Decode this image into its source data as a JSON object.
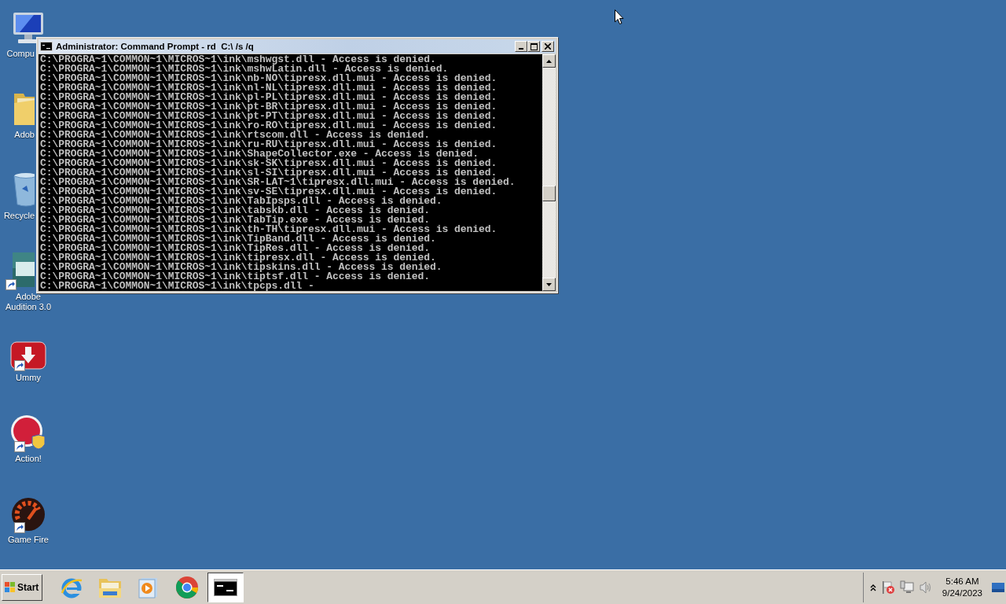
{
  "desktop": {
    "icons": [
      {
        "kind": "computer",
        "label": "Compu",
        "shortcut": false
      },
      {
        "kind": "folder",
        "label": "Adob",
        "shortcut": false
      },
      {
        "kind": "recycle",
        "label": "Recycle",
        "shortcut": false
      },
      {
        "kind": "audition",
        "label": "Adobe\nAudition 3.0",
        "shortcut": true
      },
      {
        "kind": "ummy",
        "label": "Ummy",
        "shortcut": true
      },
      {
        "kind": "action",
        "label": "Action!",
        "shortcut": true
      },
      {
        "kind": "gamefire",
        "label": "Game Fire",
        "shortcut": true
      }
    ]
  },
  "window": {
    "title": "Administrator: Command Prompt - rd  C:\\ /s /q",
    "lines": [
      "C:\\PROGRA~1\\COMMON~1\\MICROS~1\\ink\\mshwgst.dll - Access is denied.",
      "C:\\PROGRA~1\\COMMON~1\\MICROS~1\\ink\\mshwLatin.dll - Access is denied.",
      "C:\\PROGRA~1\\COMMON~1\\MICROS~1\\ink\\nb-NO\\tipresx.dll.mui - Access is denied.",
      "C:\\PROGRA~1\\COMMON~1\\MICROS~1\\ink\\nl-NL\\tipresx.dll.mui - Access is denied.",
      "C:\\PROGRA~1\\COMMON~1\\MICROS~1\\ink\\pl-PL\\tipresx.dll.mui - Access is denied.",
      "C:\\PROGRA~1\\COMMON~1\\MICROS~1\\ink\\pt-BR\\tipresx.dll.mui - Access is denied.",
      "C:\\PROGRA~1\\COMMON~1\\MICROS~1\\ink\\pt-PT\\tipresx.dll.mui - Access is denied.",
      "C:\\PROGRA~1\\COMMON~1\\MICROS~1\\ink\\ro-RO\\tipresx.dll.mui - Access is denied.",
      "C:\\PROGRA~1\\COMMON~1\\MICROS~1\\ink\\rtscom.dll - Access is denied.",
      "C:\\PROGRA~1\\COMMON~1\\MICROS~1\\ink\\ru-RU\\tipresx.dll.mui - Access is denied.",
      "C:\\PROGRA~1\\COMMON~1\\MICROS~1\\ink\\ShapeCollector.exe - Access is denied.",
      "C:\\PROGRA~1\\COMMON~1\\MICROS~1\\ink\\sk-SK\\tipresx.dll.mui - Access is denied.",
      "C:\\PROGRA~1\\COMMON~1\\MICROS~1\\ink\\sl-SI\\tipresx.dll.mui - Access is denied.",
      "C:\\PROGRA~1\\COMMON~1\\MICROS~1\\ink\\SR-LAT~1\\tipresx.dll.mui - Access is denied.",
      "C:\\PROGRA~1\\COMMON~1\\MICROS~1\\ink\\sv-SE\\tipresx.dll.mui - Access is denied.",
      "C:\\PROGRA~1\\COMMON~1\\MICROS~1\\ink\\TabIpsps.dll - Access is denied.",
      "C:\\PROGRA~1\\COMMON~1\\MICROS~1\\ink\\tabskb.dll - Access is denied.",
      "C:\\PROGRA~1\\COMMON~1\\MICROS~1\\ink\\TabTip.exe - Access is denied.",
      "C:\\PROGRA~1\\COMMON~1\\MICROS~1\\ink\\th-TH\\tipresx.dll.mui - Access is denied.",
      "C:\\PROGRA~1\\COMMON~1\\MICROS~1\\ink\\TipBand.dll - Access is denied.",
      "C:\\PROGRA~1\\COMMON~1\\MICROS~1\\ink\\TipRes.dll - Access is denied.",
      "C:\\PROGRA~1\\COMMON~1\\MICROS~1\\ink\\tipresx.dll - Access is denied.",
      "C:\\PROGRA~1\\COMMON~1\\MICROS~1\\ink\\tipskins.dll - Access is denied.",
      "C:\\PROGRA~1\\COMMON~1\\MICROS~1\\ink\\tiptsf.dll - Access is denied.",
      "C:\\PROGRA~1\\COMMON~1\\MICROS~1\\ink\\tpcps.dll -"
    ]
  },
  "taskbar": {
    "start": "Start",
    "apps": [
      {
        "kind": "ie",
        "selected": false
      },
      {
        "kind": "explorer",
        "selected": false
      },
      {
        "kind": "media",
        "selected": false
      },
      {
        "kind": "chrome",
        "selected": false
      },
      {
        "kind": "cmd",
        "selected": true
      }
    ],
    "tray": {
      "time": "5:46 AM",
      "date": "9/24/2023"
    }
  }
}
